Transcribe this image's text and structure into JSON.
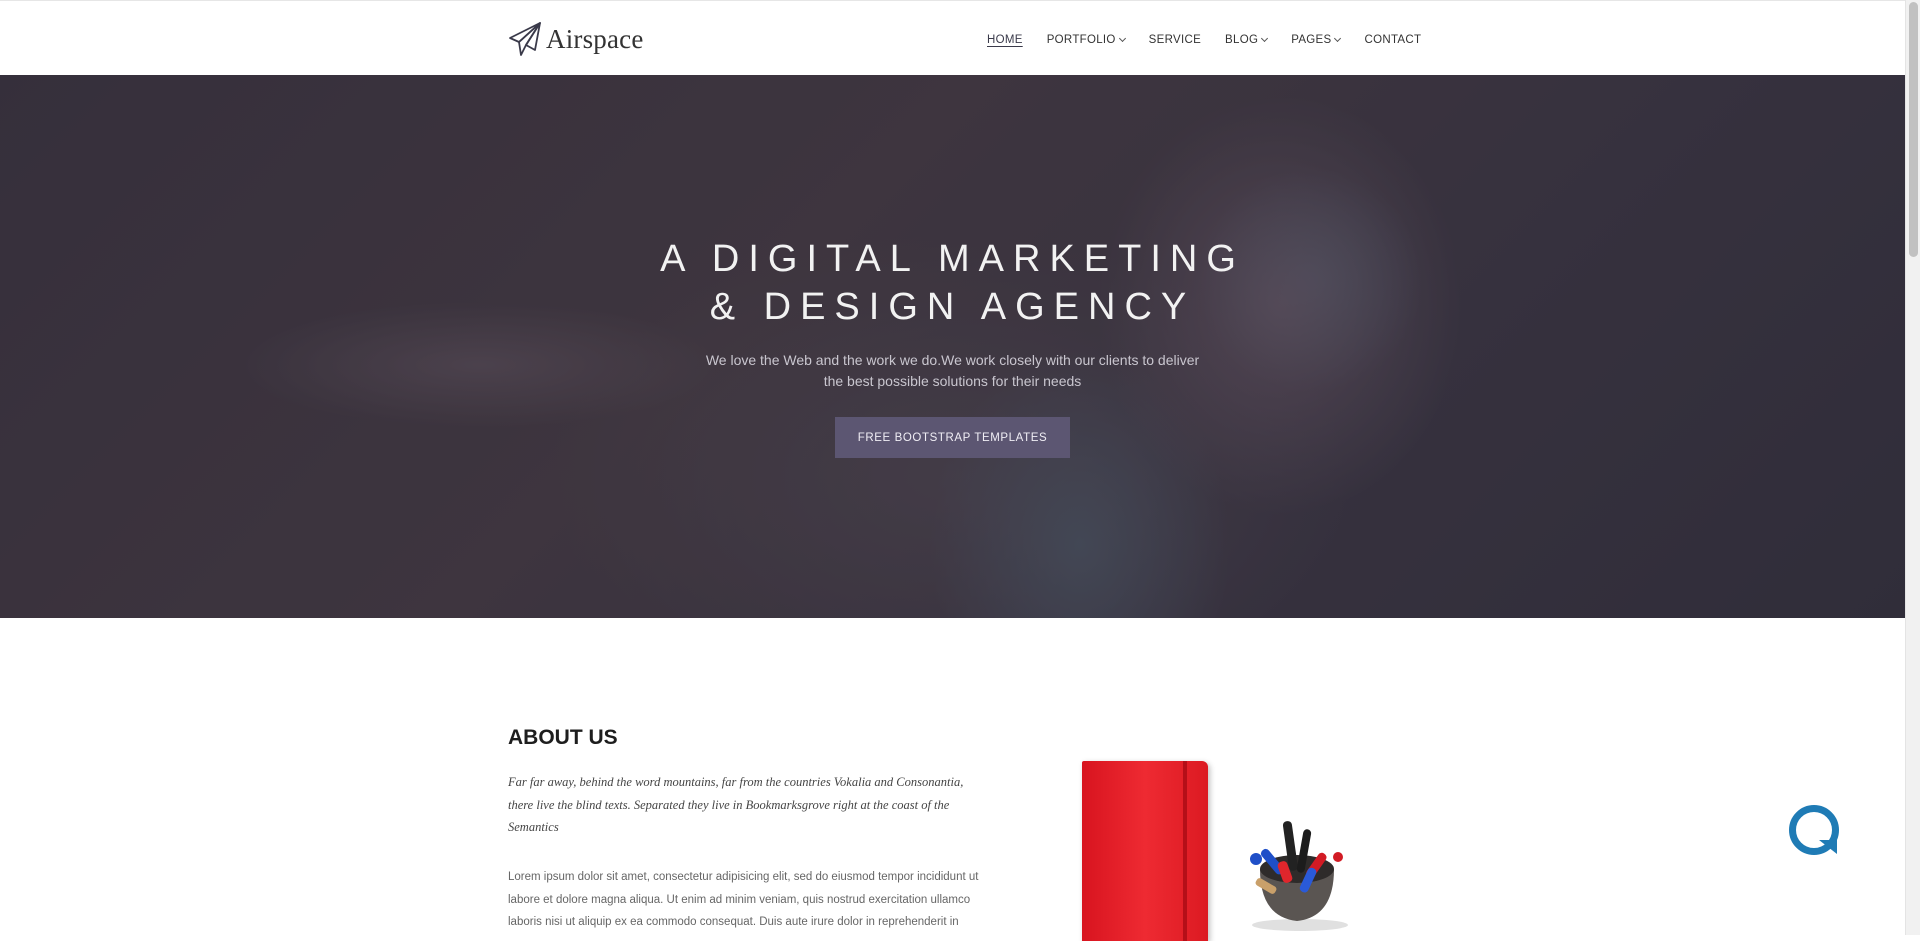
{
  "header": {
    "logo_text": "Airspace",
    "nav": [
      {
        "label": "HOME",
        "active": true,
        "dropdown": false
      },
      {
        "label": "PORTFOLIO",
        "active": false,
        "dropdown": true
      },
      {
        "label": "SERVICE",
        "active": false,
        "dropdown": false
      },
      {
        "label": "BLOG",
        "active": false,
        "dropdown": true
      },
      {
        "label": "PAGES",
        "active": false,
        "dropdown": true
      },
      {
        "label": "CONTACT",
        "active": false,
        "dropdown": false
      }
    ]
  },
  "hero": {
    "title_line1": "A DIGITAL MARKETING",
    "title_line2": "& DESIGN AGENCY",
    "subtitle_line1": "We love the Web and the work we do.We work closely with our clients to deliver",
    "subtitle_line2": "the best possible solutions for their needs",
    "button_label": "FREE BOOTSTRAP TEMPLATES",
    "button_color": "#5c5672"
  },
  "about": {
    "title": "ABOUT US",
    "quote_lines": [
      "Far far away, behind the word mountains, far from the countries Vokalia and Consonantia,",
      "there live the blind texts. Separated they live in Bookmarksgrove right at the coast of the",
      "Semantics"
    ],
    "text_lines": [
      "Lorem ipsum dolor sit amet, consectetur adipisicing elit, sed do eiusmod tempor incididunt ut",
      "labore et dolore magna aliqua. Ut enim ad minim veniam, quis nostrud exercitation ullamco",
      "laboris nisi ut aliquip ex ea commodo consequat. Duis aute irure dolor in reprehenderit in"
    ]
  },
  "chat_widget": {
    "icon": "chat-bubble-icon",
    "color": "#1f7bb5"
  }
}
